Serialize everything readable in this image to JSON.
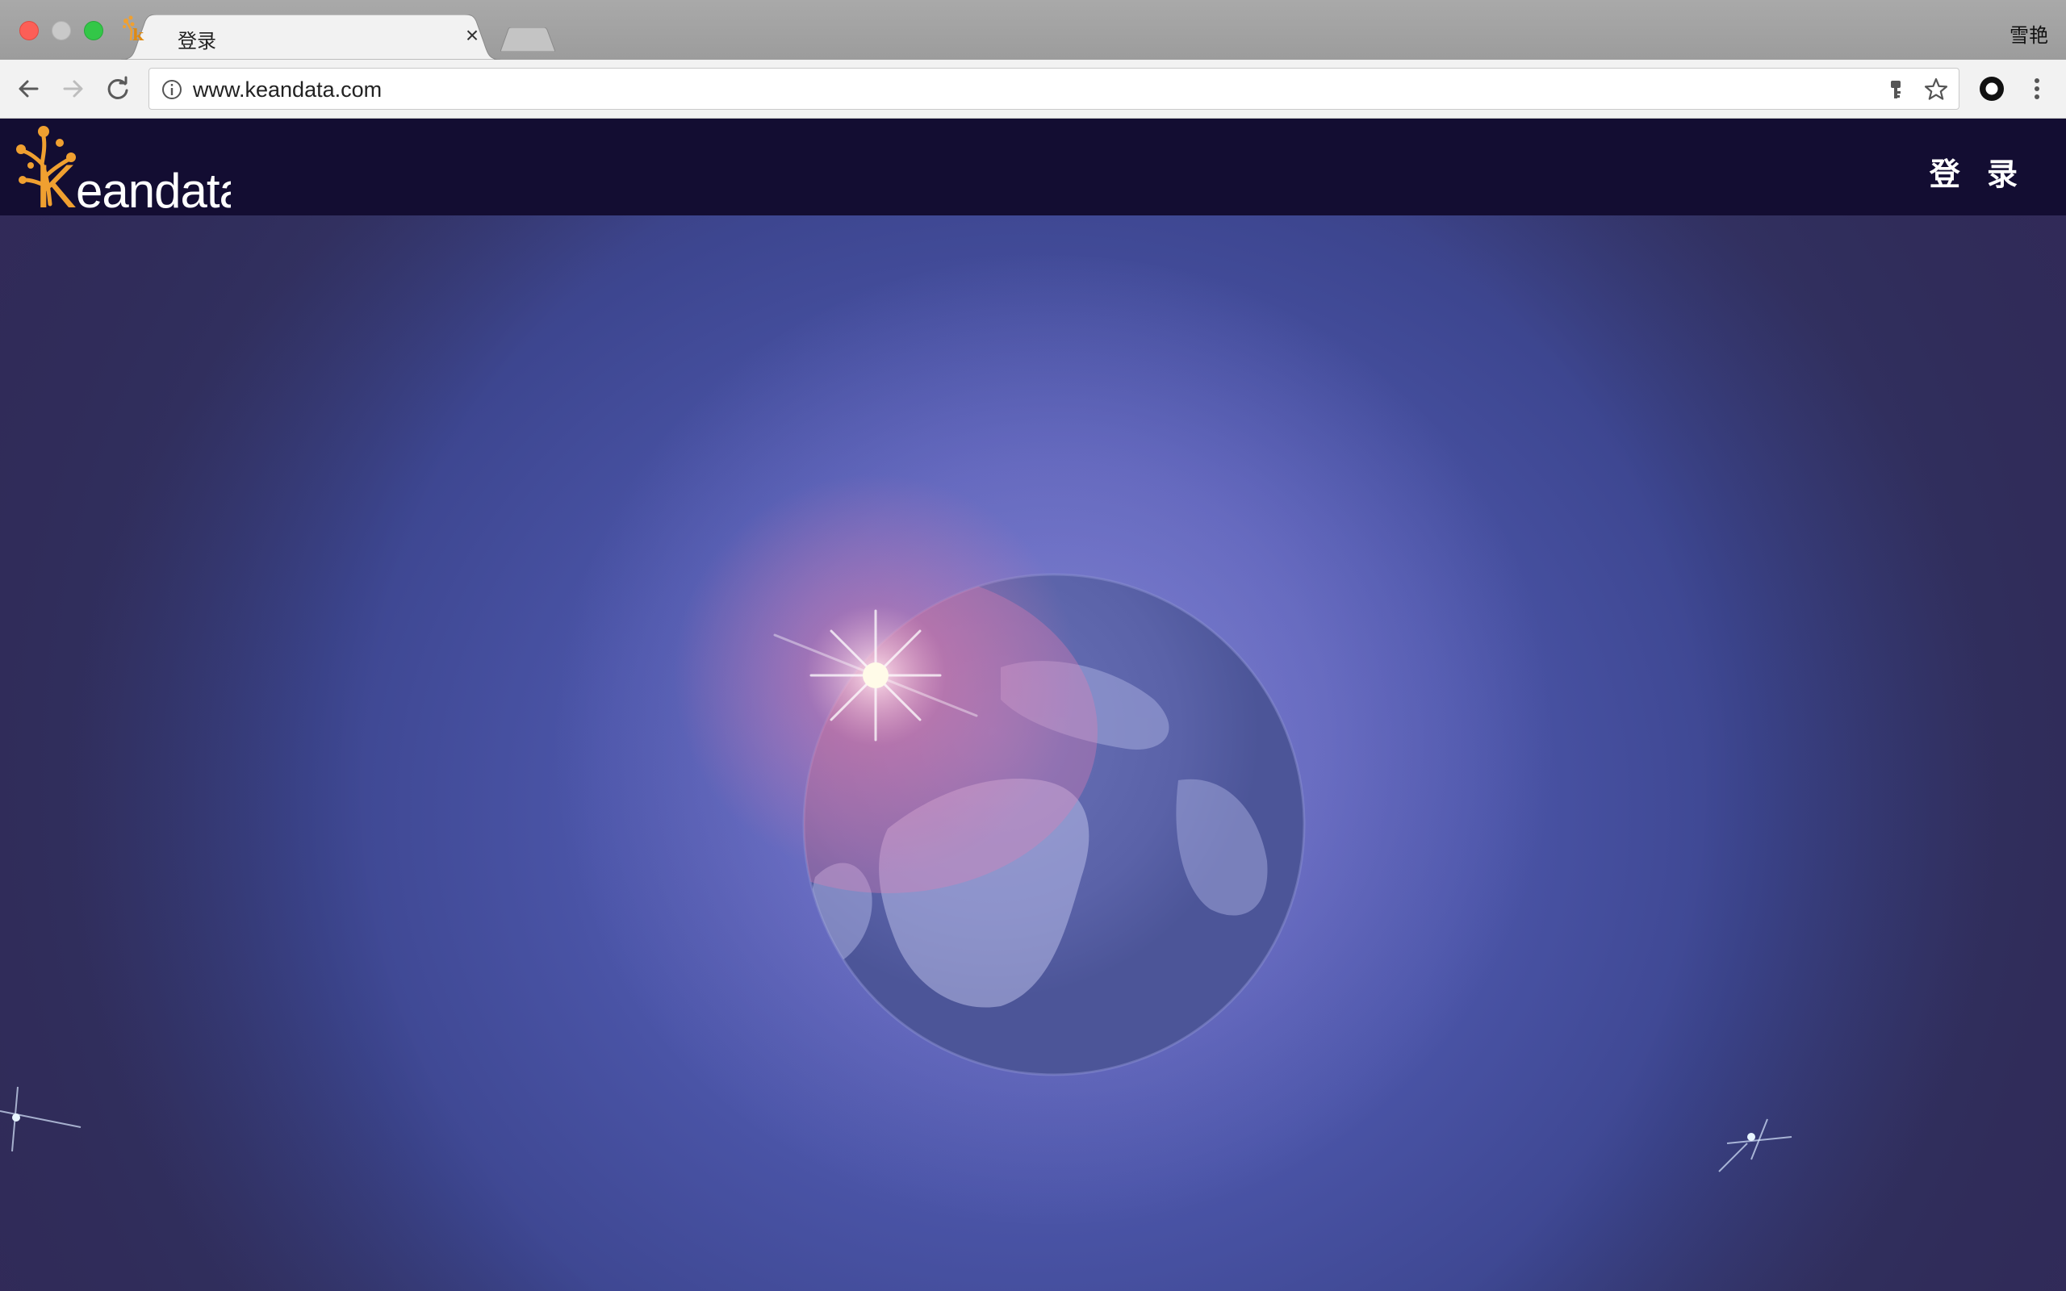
{
  "browser": {
    "tab": {
      "title": "登录",
      "close_glyph": "×"
    },
    "profile_name": "雪艳",
    "address_bar": {
      "url": "www.keandata.com"
    },
    "icons": {
      "back": "arrow-left-icon",
      "forward": "arrow-right-icon",
      "reload": "reload-icon",
      "info": "info-icon",
      "key": "key-icon",
      "star": "star-icon",
      "extension": "circle-extension-icon",
      "menu": "kebab-menu-icon"
    }
  },
  "site": {
    "brand": "Keandata",
    "login_label": "登 录",
    "header_color": "#130d32",
    "accent_color": "#f0a030"
  }
}
